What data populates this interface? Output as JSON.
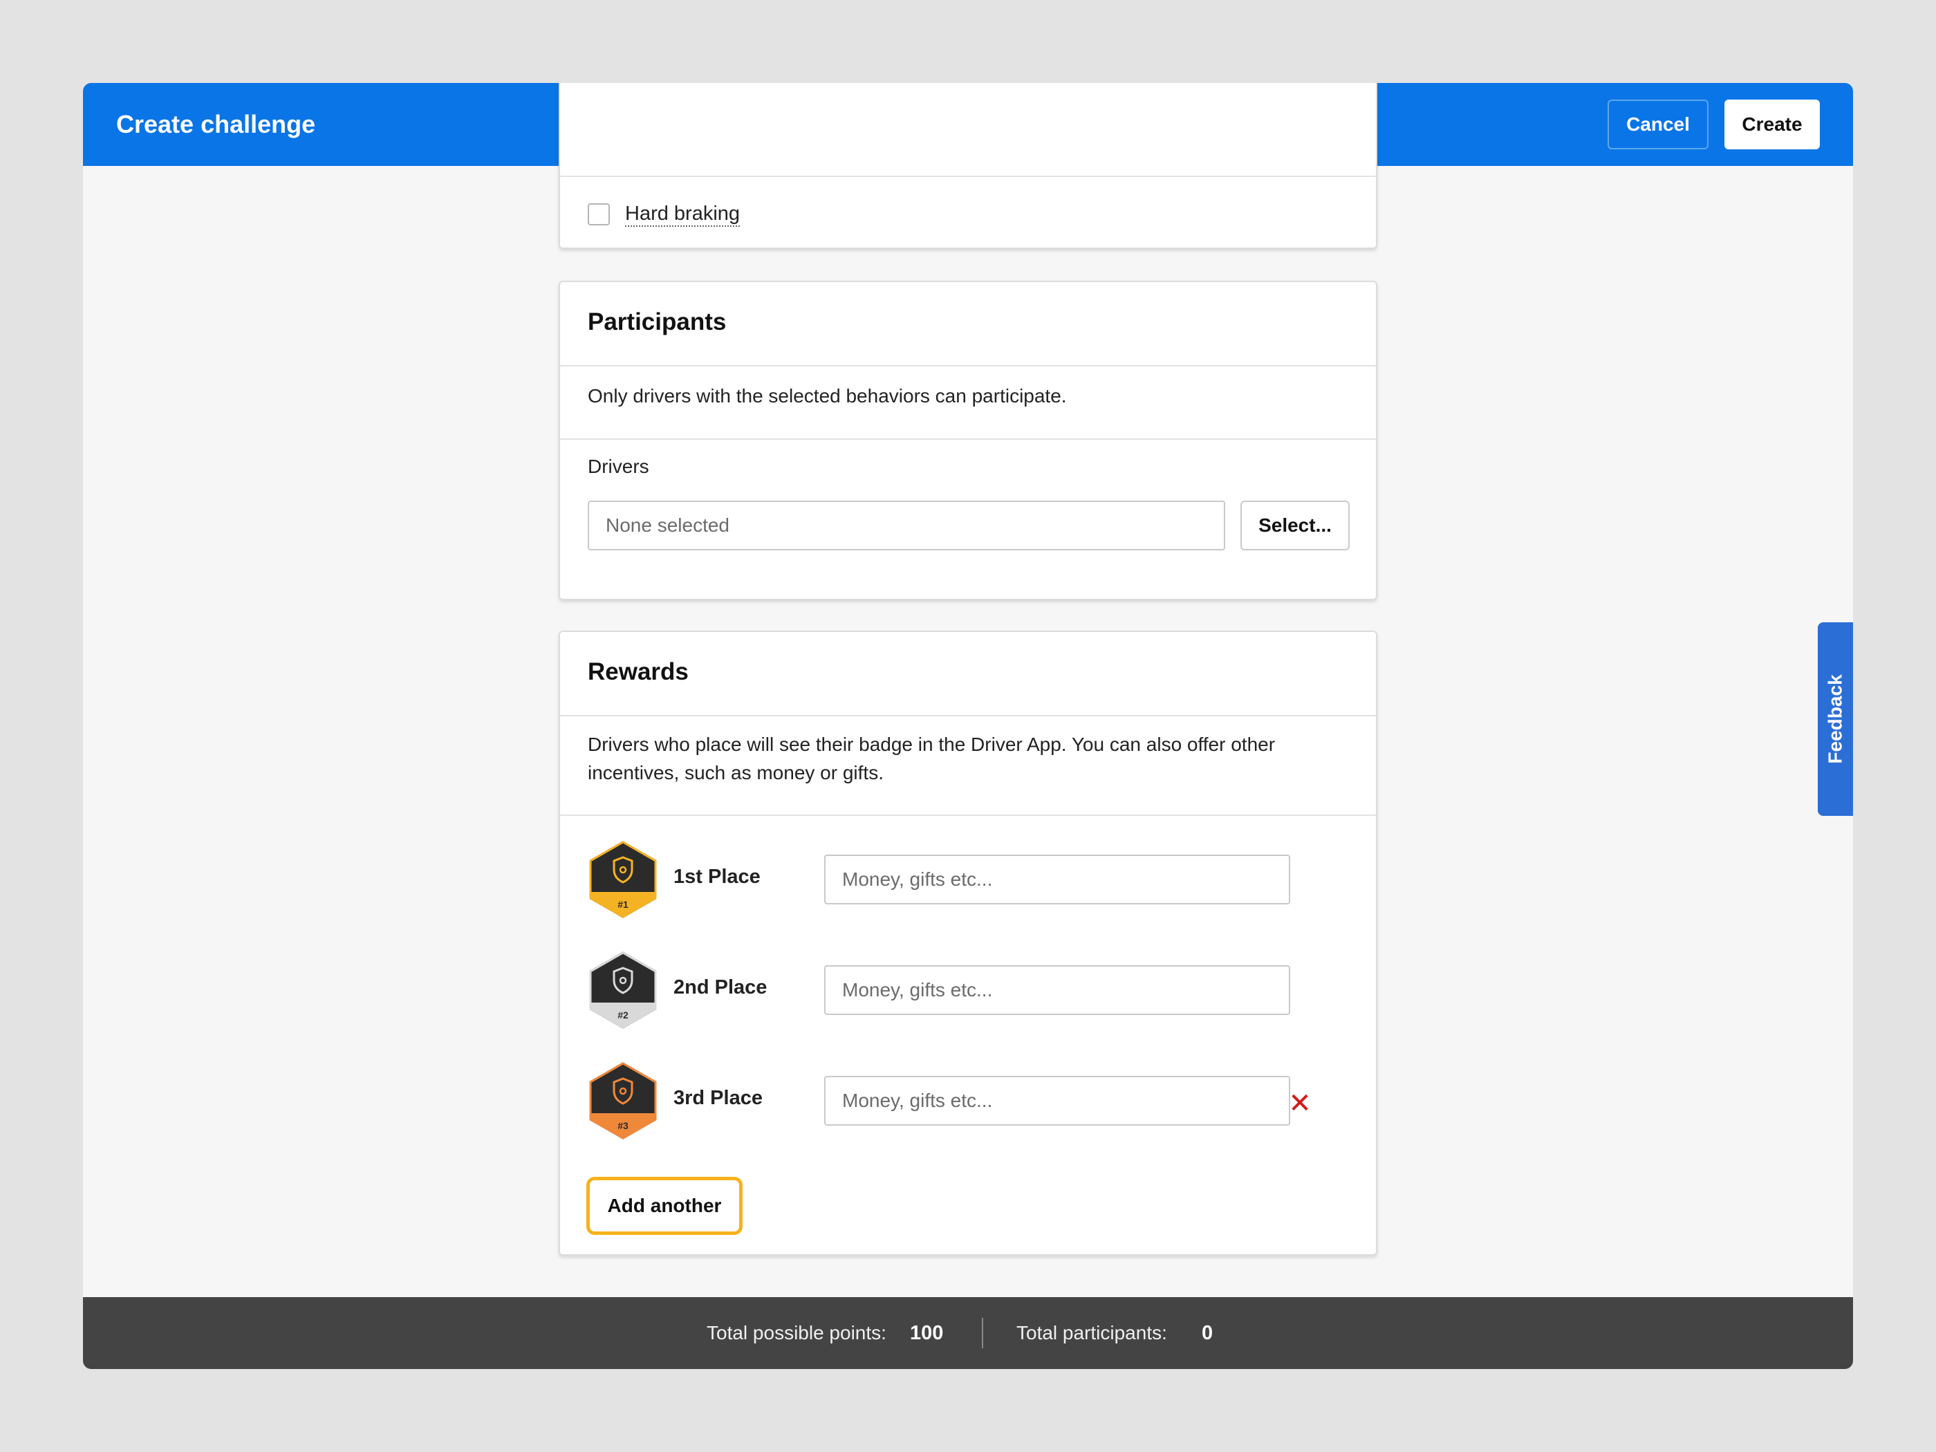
{
  "header": {
    "title": "Create challenge",
    "cancel_label": "Cancel",
    "create_label": "Create"
  },
  "behaviors": {
    "item_label": "Hard braking",
    "checked": false
  },
  "participants": {
    "title": "Participants",
    "description": "Only drivers with the selected behaviors can participate.",
    "drivers_label": "Drivers",
    "drivers_placeholder": "None selected",
    "select_label": "Select..."
  },
  "rewards": {
    "title": "Rewards",
    "description": "Drivers who place will see their badge in the Driver App. You can also offer other incentives, such as money or gifts.",
    "items": [
      {
        "label": "1st Place",
        "badge_text": "#1",
        "placeholder": "Money, gifts etc...",
        "color": "#f5b324"
      },
      {
        "label": "2nd Place",
        "badge_text": "#2",
        "placeholder": "Money, gifts etc...",
        "color": "#d9d9d9"
      },
      {
        "label": "3rd Place",
        "badge_text": "#3",
        "placeholder": "Money, gifts etc...",
        "color": "#f0883a"
      }
    ],
    "remove_symbol": "✕",
    "add_label": "Add another"
  },
  "footer": {
    "points_label": "Total possible points:",
    "points_value": "100",
    "participants_label": "Total participants:",
    "participants_value": "0"
  },
  "feedback_label": "Feedback",
  "colors": {
    "header": "#0a75e6",
    "footer": "#444444",
    "focus_ring": "#f6b21c",
    "remove": "#d21919"
  }
}
